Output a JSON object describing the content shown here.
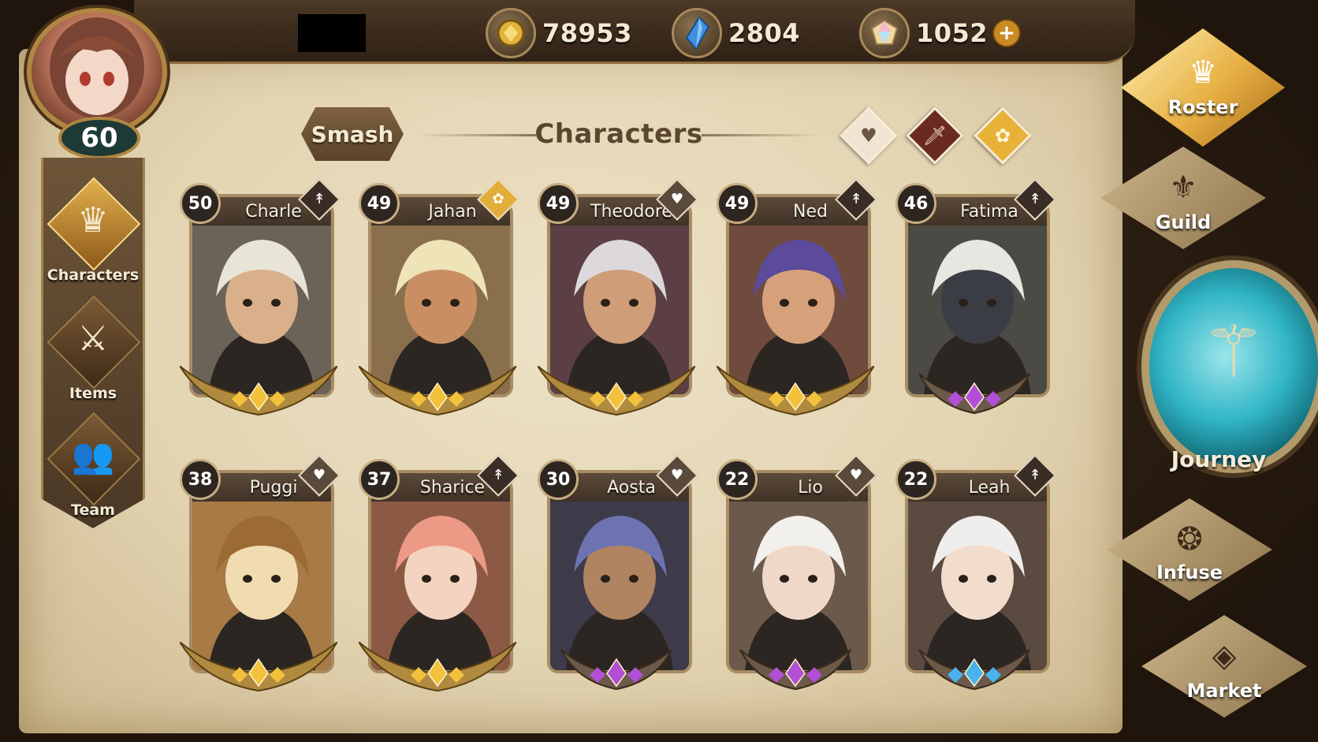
{
  "player": {
    "level": "60"
  },
  "currencies": [
    {
      "name": "gold",
      "icon": "gold-coin-icon",
      "value": "78953"
    },
    {
      "name": "gems",
      "icon": "blue-crystal-icon",
      "value": "2804"
    },
    {
      "name": "premium",
      "icon": "rainbow-gem-icon",
      "value": "1052",
      "plus": "+"
    }
  ],
  "left_nav": [
    {
      "label": "Characters",
      "icon": "helmet-icon",
      "glyph": "♛",
      "active": true
    },
    {
      "label": "Items",
      "icon": "armor-icon",
      "glyph": "⚔",
      "active": false
    },
    {
      "label": "Team",
      "icon": "team-icon",
      "glyph": "👥",
      "active": false
    }
  ],
  "header": {
    "smash_label": "Smash",
    "title": "Characters",
    "filters": [
      {
        "icon": "heart-icon",
        "glyph": "♥",
        "color": "#efe5d2",
        "glyph_color": "#6a5540"
      },
      {
        "icon": "sword-icon",
        "glyph": "🗡",
        "color": "#6a2a22",
        "glyph_color": "#f1e2c8"
      },
      {
        "icon": "paw-icon",
        "glyph": "✿",
        "color": "#e8b238",
        "glyph_color": "#fff6da"
      }
    ]
  },
  "characters": [
    {
      "name": "Charle",
      "level": "50",
      "role_icon": "sword-icon",
      "role_glyph": "↟",
      "role_color": "#3a2d25",
      "rarity": "gold",
      "hair": "#e8e4d8",
      "skin": "#d9b08a",
      "bg": "#6b6258"
    },
    {
      "name": "Jahan",
      "level": "49",
      "role_icon": "paw-icon",
      "role_glyph": "✿",
      "role_color": "#e3ad3a",
      "rarity": "gold",
      "hair": "#efe3b8",
      "skin": "#c98f62",
      "bg": "#8a6f4d"
    },
    {
      "name": "Theodore",
      "level": "49",
      "role_icon": "heart-icon",
      "role_glyph": "♥",
      "role_color": "#5a4a3c",
      "rarity": "gold",
      "hair": "#dcd8dc",
      "skin": "#cf9e78",
      "bg": "#5c3f44"
    },
    {
      "name": "Ned",
      "level": "49",
      "role_icon": "sword-icon",
      "role_glyph": "↟",
      "role_color": "#3a2d25",
      "rarity": "gold",
      "hair": "#5c4a9a",
      "skin": "#d6a07a",
      "bg": "#6e4b3c"
    },
    {
      "name": "Fatima",
      "level": "46",
      "role_icon": "sword-icon",
      "role_glyph": "↟",
      "role_color": "#3a2d25",
      "rarity": "purple",
      "hair": "#e8e6e0",
      "skin": "#3b3d44",
      "bg": "#4b4a44"
    },
    {
      "name": "Puggi",
      "level": "38",
      "role_icon": "heart-icon",
      "role_glyph": "♥",
      "role_color": "#5a4a3c",
      "rarity": "gold",
      "hair": "#9c6a34",
      "skin": "#f1dcb2",
      "bg": "#a77a46"
    },
    {
      "name": "Sharice",
      "level": "37",
      "role_icon": "sword-icon",
      "role_glyph": "↟",
      "role_color": "#3a2d25",
      "rarity": "gold",
      "hair": "#ec9a86",
      "skin": "#f4d4c0",
      "bg": "#8c5a44"
    },
    {
      "name": "Aosta",
      "level": "30",
      "role_icon": "heart-icon",
      "role_glyph": "♥",
      "role_color": "#5a4a3c",
      "rarity": "purple",
      "hair": "#6c73b0",
      "skin": "#b08460",
      "bg": "#3d3a4a"
    },
    {
      "name": "Lio",
      "level": "22",
      "role_icon": "heart-icon",
      "role_glyph": "♥",
      "role_color": "#5a4a3c",
      "rarity": "purple",
      "hair": "#f2f0ec",
      "skin": "#f0d8c8",
      "bg": "#6b5a4c"
    },
    {
      "name": "Leah",
      "level": "22",
      "role_icon": "sword-icon",
      "role_glyph": "↟",
      "role_color": "#3a2d25",
      "rarity": "blue",
      "hair": "#f0eeec",
      "skin": "#f2dccc",
      "bg": "#5a4a40"
    }
  ],
  "right_nav": [
    {
      "label": "Roster",
      "icon": "helmet-icon",
      "glyph": "♛",
      "active": true
    },
    {
      "label": "Guild",
      "icon": "dragon-icon",
      "glyph": "⚜",
      "active": false
    },
    {
      "label": "Journey",
      "icon": "trident-icon",
      "glyph": "⚚"
    },
    {
      "label": "Infuse",
      "icon": "swirl-icon",
      "glyph": "❂",
      "active": false
    },
    {
      "label": "Market",
      "icon": "gem-icon",
      "glyph": "◈",
      "active": false
    }
  ],
  "colors": {
    "gold": "#f2c23c",
    "purple": "#b24fd6",
    "blue": "#4ab2ee"
  }
}
